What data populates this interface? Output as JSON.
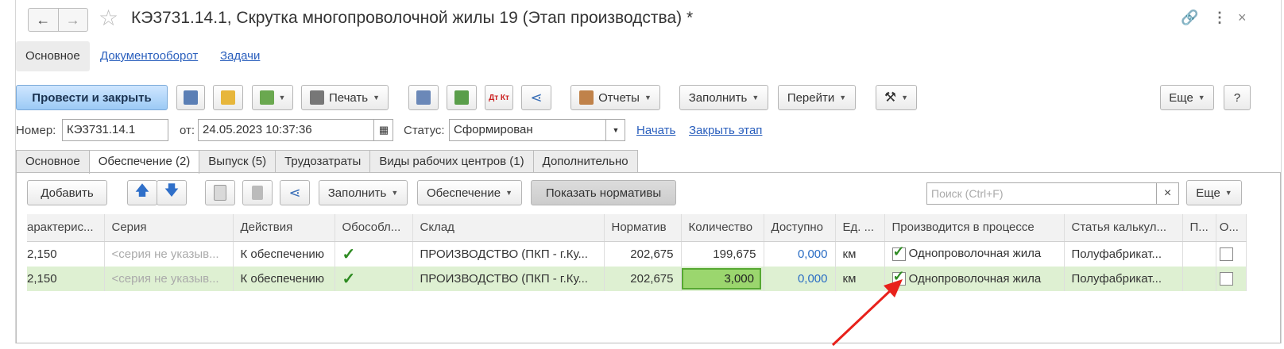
{
  "window": {
    "title": "КЭ3731.14.1, Скрутка многопроволочной жилы 19 (Этап производства) *"
  },
  "top_tabs": [
    "Основное",
    "Документооборот",
    "Задачи"
  ],
  "toolbar": {
    "post_close": "Провести и закрыть",
    "print": "Печать",
    "reports": "Отчеты",
    "fill": "Заполнить",
    "goto": "Перейти",
    "more": "Еще",
    "help": "?",
    "dtkt": "Дт Кт"
  },
  "header_fields": {
    "number_label": "Номер:",
    "number_value": "КЭ3731.14.1",
    "date_label": "от:",
    "date_value": "24.05.2023 10:37:36",
    "status_label": "Статус:",
    "status_value": "Сформирован",
    "start_link": "Начать",
    "close_stage_link": "Закрыть этап"
  },
  "doc_tabs": [
    "Основное",
    "Обеспечение (2)",
    "Выпуск (5)",
    "Трудозатраты",
    "Виды рабочих центров (1)",
    "Дополнительно"
  ],
  "table_toolbar": {
    "add": "Добавить",
    "fill": "Заполнить",
    "supply": "Обеспечение",
    "show_norms": "Показать нормативы",
    "search_placeholder": "Поиск (Ctrl+F)",
    "more": "Еще"
  },
  "grid": {
    "columns": [
      "арактерис...",
      "Серия",
      "Действия",
      "Обособл...",
      "Склад",
      "Норматив",
      "Количество",
      "Доступно",
      "Ед. ...",
      "Производится в процессе",
      "Статья калькул...",
      "П...",
      "О..."
    ],
    "rows": [
      {
        "char": "2,150",
        "series": "<серия не указыв...",
        "action": "К обеспечению",
        "isolated": true,
        "warehouse": "ПРОИЗВОДСТВО (ПКП - г.Ку...",
        "norm": "202,675",
        "qty": "199,675",
        "avail": "0,000",
        "unit": "км",
        "in_process": true,
        "process_name": "Однопроволочная жила",
        "calc_item": "Полуфабрикат...",
        "o": false
      },
      {
        "char": "2,150",
        "series": "<серия не указыв...",
        "action": "К обеспечению",
        "isolated": true,
        "warehouse": "ПРОИЗВОДСТВО (ПКП - г.Ку...",
        "norm": "202,675",
        "qty": "3,000",
        "avail": "0,000",
        "unit": "км",
        "in_process": true,
        "process_name": "Однопроволочная жила",
        "calc_item": "Полуфабрикат...",
        "o": false
      }
    ]
  },
  "colors": {
    "accent": "#2a5fbd",
    "selected_row": "#def0d2",
    "edit_cell": "#9bd66e",
    "arrow": "#e8211b"
  },
  "icons": [
    "back-arrow-icon",
    "forward-arrow-icon",
    "star-icon",
    "link-icon",
    "more-vertical-icon",
    "close-icon"
  ]
}
